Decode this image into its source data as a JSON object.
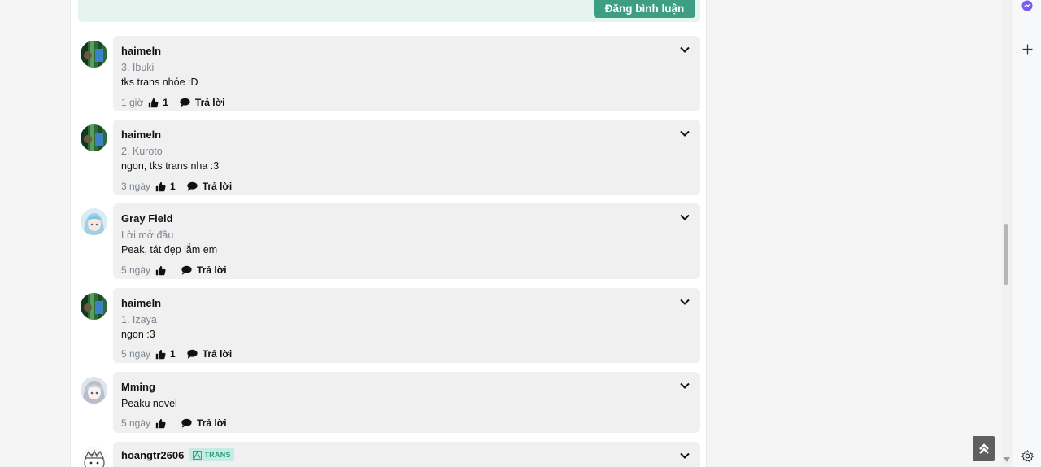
{
  "post": {
    "button_label": "Đăng bình luận"
  },
  "reply_label": "Trả lời",
  "badge_label": "TRANS",
  "comments": [
    {
      "user": "haimeln",
      "avatar": "forest",
      "chapter": "3. Ibuki",
      "text": "tks trans nhóe :D",
      "time": "1 giờ",
      "likes": "1"
    },
    {
      "user": "haimeln",
      "avatar": "forest",
      "chapter": "2. Kuroto",
      "text": "ngon, tks trans nha :3",
      "time": "3 ngày",
      "likes": "1"
    },
    {
      "user": "Gray Field",
      "avatar": "anime-blue",
      "chapter": "Lời mở đầu",
      "text": "Peak, tát đẹp lắm em",
      "time": "5 ngày",
      "likes": ""
    },
    {
      "user": "haimeln",
      "avatar": "forest",
      "chapter": "1. Izaya",
      "text": "ngon :3",
      "time": "5 ngày",
      "likes": "1"
    },
    {
      "user": "Mming",
      "avatar": "anime-grey",
      "chapter": "",
      "text": "Peaku novel",
      "time": "5 ngày",
      "likes": ""
    },
    {
      "user": "hoangtr2606",
      "avatar": "chibi",
      "badge": "TRANS"
    }
  ],
  "colors": {
    "accent": "#3d9e82",
    "bubble": "#f0f0f0",
    "muted": "#7a8590"
  }
}
